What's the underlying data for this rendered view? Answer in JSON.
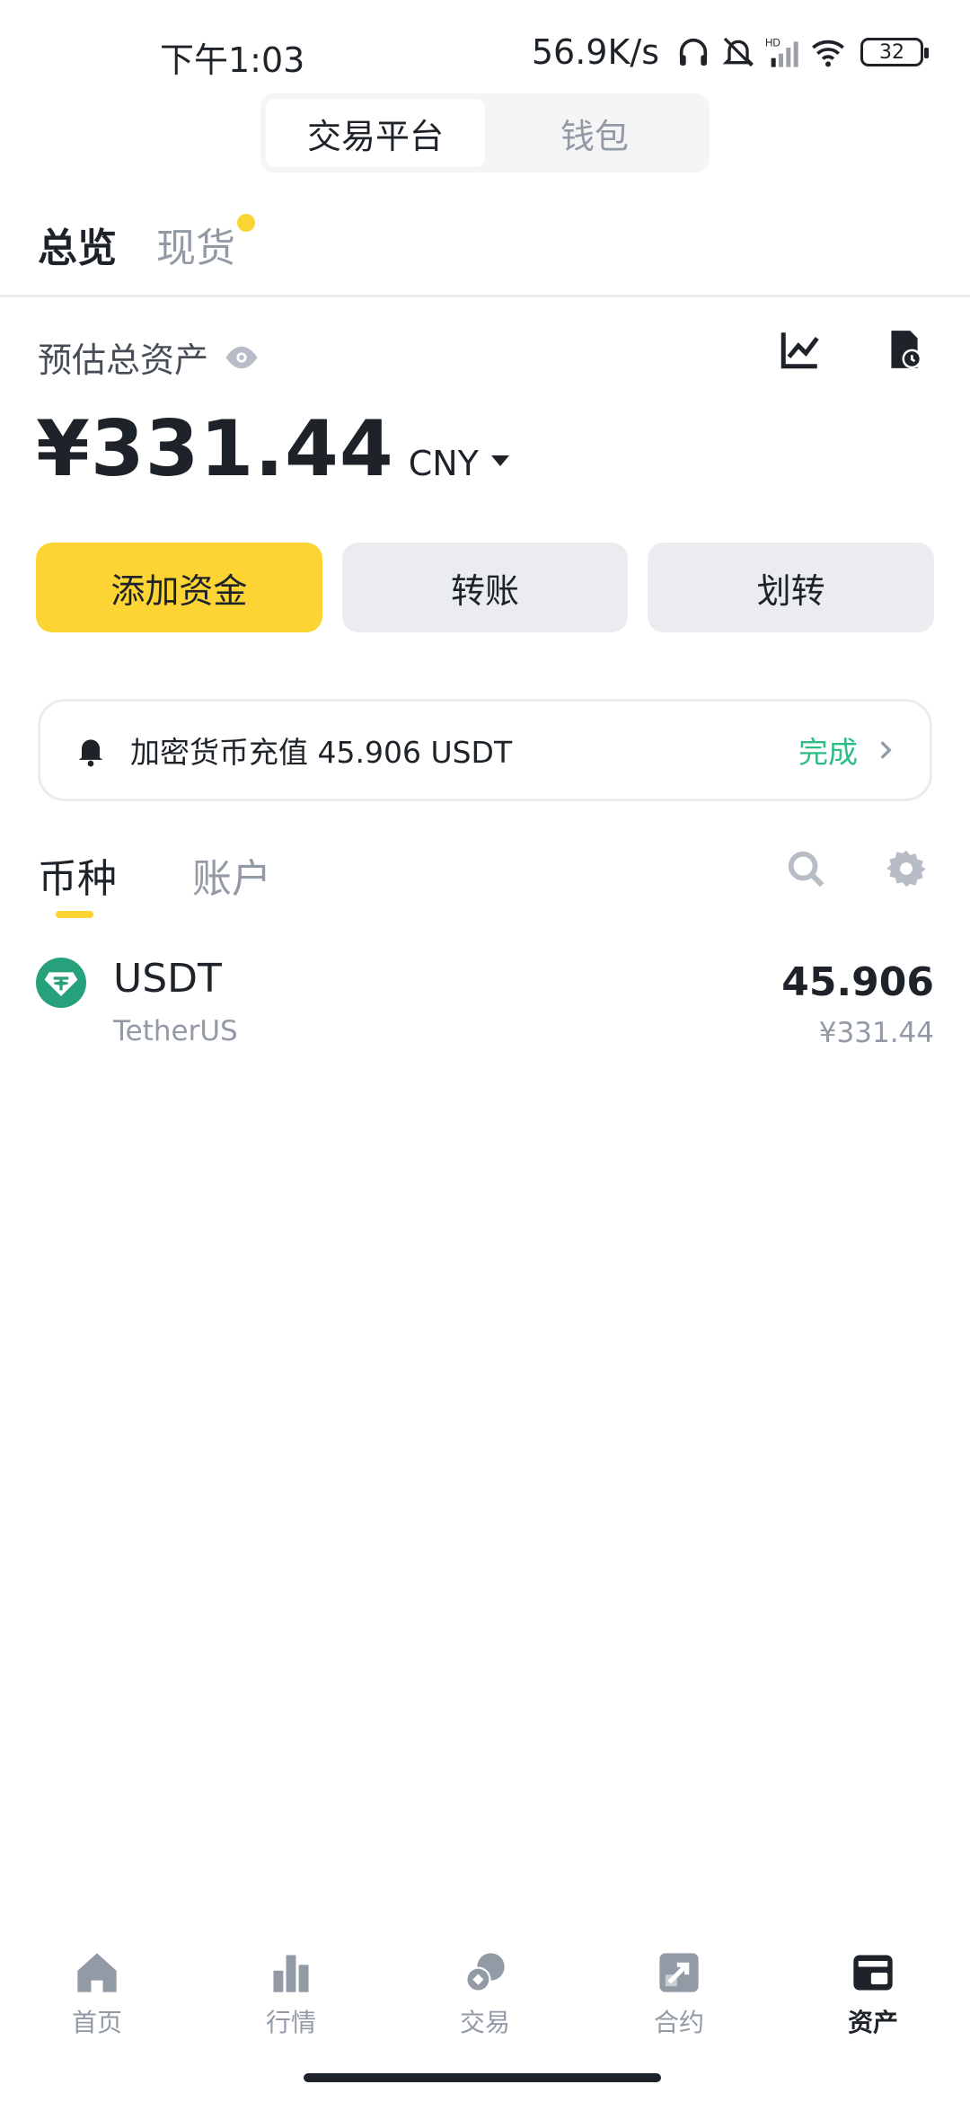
{
  "status_bar": {
    "time": "下午1:03",
    "net_speed": "56.9K/s",
    "battery": "32",
    "icons": [
      "headphones-icon",
      "mute-bell-icon",
      "hd-signal-icon",
      "wifi-icon",
      "battery-icon"
    ]
  },
  "top_switch": {
    "tabs": [
      {
        "label": "交易平台",
        "active": true
      },
      {
        "label": "钱包",
        "active": false
      }
    ]
  },
  "overview_tabs": [
    {
      "label": "总览",
      "active": true
    },
    {
      "label": "现货",
      "active": false,
      "badge_dot": true
    }
  ],
  "summary": {
    "label": "预估总资产",
    "balance": "¥331.44",
    "currency": "CNY"
  },
  "actions": {
    "add_funds": "添加资金",
    "transfer": "转账",
    "internal_transfer": "划转"
  },
  "notice": {
    "text": "加密货币充值 45.906 USDT",
    "status": "完成"
  },
  "list_tabs": [
    {
      "label": "币种",
      "active": true
    },
    {
      "label": "账户",
      "active": false
    }
  ],
  "assets": [
    {
      "symbol": "USDT",
      "name": "TetherUS",
      "amount": "45.906",
      "fiat": "¥331.44"
    }
  ],
  "bottom_nav": [
    {
      "label": "首页",
      "icon": "home-icon",
      "active": false
    },
    {
      "label": "行情",
      "icon": "bar-chart-icon",
      "active": false
    },
    {
      "label": "交易",
      "icon": "trade-icon",
      "active": false
    },
    {
      "label": "合约",
      "icon": "futures-icon",
      "active": false
    },
    {
      "label": "资产",
      "icon": "wallet-icon",
      "active": true
    }
  ],
  "colors": {
    "accent": "#fcd535",
    "success": "#2ebd85",
    "text": "#1e2329",
    "muted": "#929aa5",
    "tether": "#26a17b"
  }
}
